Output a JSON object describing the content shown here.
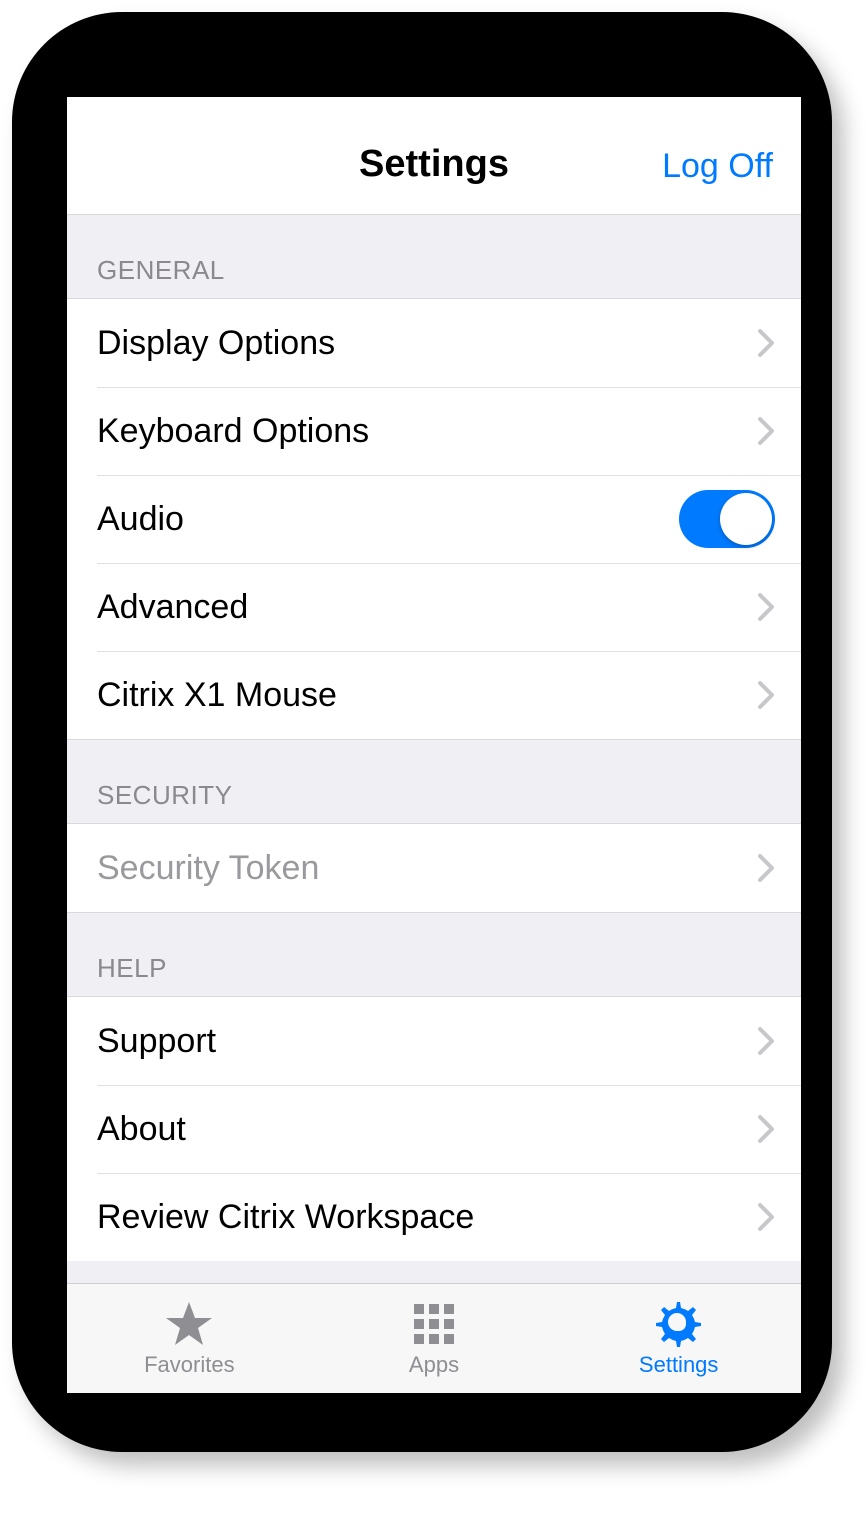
{
  "header": {
    "title": "Settings",
    "right_button": "Log Off"
  },
  "sections": {
    "general": {
      "header": "GENERAL",
      "display_options": "Display Options",
      "keyboard_options": "Keyboard Options",
      "audio": "Audio",
      "audio_on": true,
      "advanced": "Advanced",
      "x1_mouse": "Citrix X1 Mouse"
    },
    "security": {
      "header": "SECURITY",
      "security_token": "Security Token"
    },
    "help": {
      "header": "HELP",
      "support": "Support",
      "about": "About",
      "review": "Review Citrix Workspace"
    }
  },
  "tabs": {
    "favorites": "Favorites",
    "apps": "Apps",
    "settings": "Settings"
  },
  "colors": {
    "accent": "#007aff",
    "inactive": "#8e8e93"
  }
}
